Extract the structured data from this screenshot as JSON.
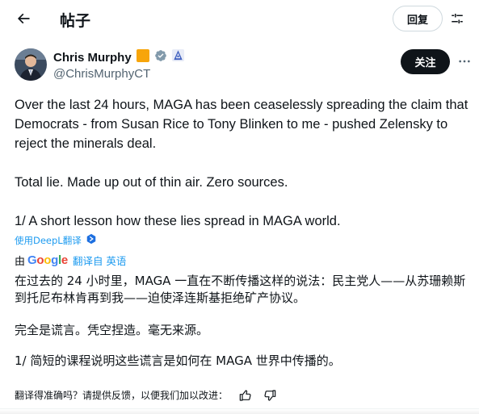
{
  "header": {
    "title": "帖子",
    "reply_label": "回复"
  },
  "author": {
    "name": "Chris Murphy",
    "handle": "@ChrisMurphyCT",
    "follow_label": "关注"
  },
  "tweet": {
    "text": "Over the last 24 hours, MAGA has been ceaselessly spreading the claim that Democrats - from Susan Rice to Tony Blinken to me - pushed Zelensky to reject the minerals deal.\n\nTotal lie. Made up out of thin air. Zero sources.\n\n1/ A short lesson how these lies spread in MAGA world."
  },
  "translation": {
    "deepl_link": "使用DeepL翻译",
    "by_label": "由",
    "google_logo": "Google",
    "translated_from": "翻译自 英语",
    "paragraph1": "在过去的 24 小时里，MAGA 一直在不断传播这样的说法：民主党人——从苏珊赖斯到托尼布林肯再到我——迫使泽连斯基拒绝矿产协议。",
    "paragraph2": "完全是谎言。凭空捏造。毫无来源。",
    "paragraph3": "1/ 简短的课程说明这些谎言是如何在 MAGA 世界中传播的。",
    "feedback_prompt": "翻译得准确吗？请提供反馈，以便我们加以改进："
  },
  "colors": {
    "accent": "#1d9bf0",
    "text": "#0f1419",
    "muted": "#536471",
    "gold_badge": "#f7a50a",
    "verified_gray": "#829aab"
  },
  "icons": [
    "back-arrow-icon",
    "settings-sliders-icon",
    "gold-square-badge-icon",
    "verified-badge-icon",
    "affiliate-badge-icon",
    "more-dots-icon",
    "deepl-icon",
    "thumbs-up-icon",
    "thumbs-down-icon"
  ]
}
